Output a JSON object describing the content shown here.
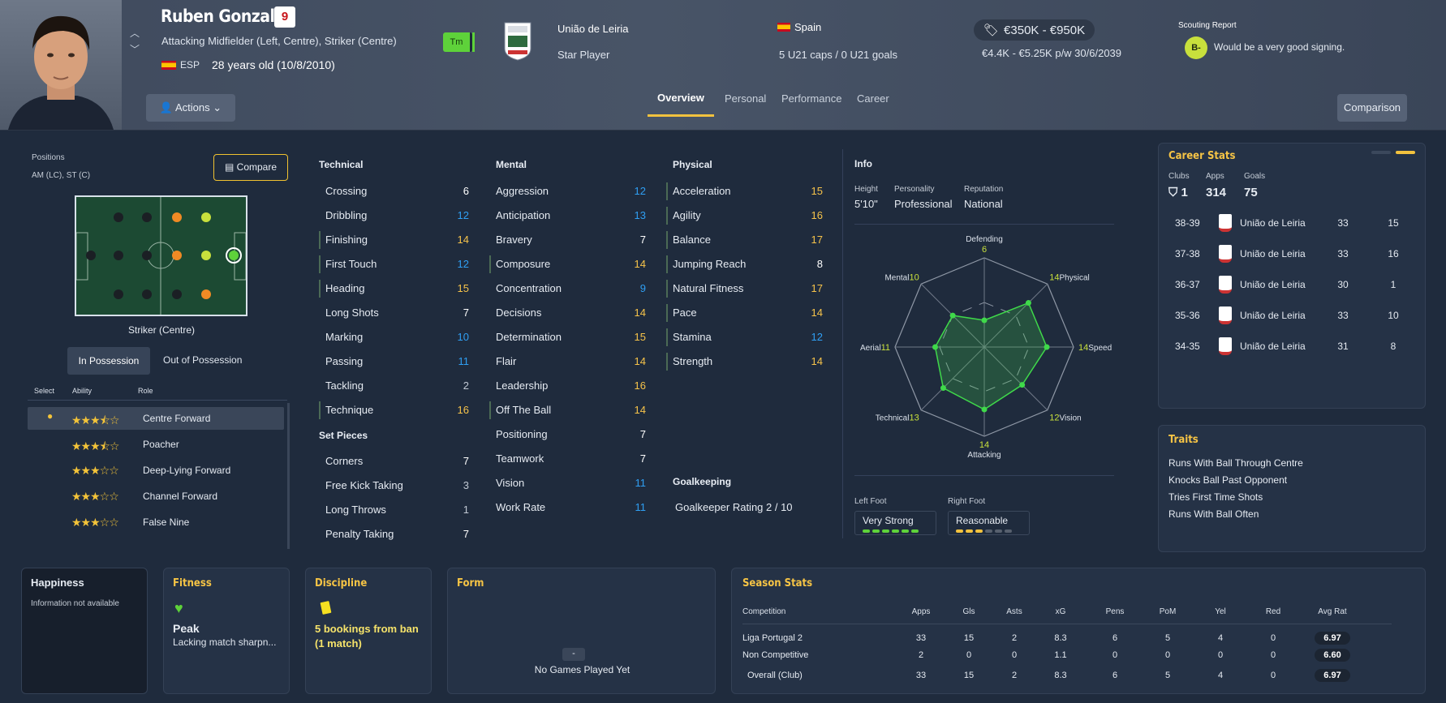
{
  "header": {
    "name": "Ruben Gonzalez",
    "shirt_number": "9",
    "positions_text": "Attacking Midfielder (Left, Centre), Striker (Centre)",
    "nationality_code": "ESP",
    "age_text": "28 years old (10/8/2010)",
    "tm_badge": "Tm",
    "club": "União de Leiria",
    "status": "Star Player",
    "country": "Spain",
    "caps": "5 U21 caps / 0 U21 goals",
    "value": "€350K - €950K",
    "wage": "€4.4K - €5.25K p/w 30/6/2039",
    "scouting_title": "Scouting Report",
    "scouting_grade": "B-",
    "scouting_text": "Would be a very good signing.",
    "actions_label": "Actions",
    "comparison_label": "Comparison",
    "tabs": [
      "Overview",
      "Personal",
      "Performance",
      "Career"
    ]
  },
  "positions": {
    "title": "Positions",
    "value": "AM (LC), ST (C)",
    "compare_label": "Compare",
    "pitch_label": "Striker (Centre)",
    "toggle": [
      "In Possession",
      "Out of Possession"
    ],
    "table_headers": [
      "Select",
      "Ability",
      "Role"
    ],
    "roles": [
      {
        "stars": "★★★⯪☆",
        "name": "Centre Forward",
        "selected": true
      },
      {
        "stars": "★★★⯪☆",
        "name": "Poacher",
        "selected": false
      },
      {
        "stars": "★★★☆☆",
        "name": "Deep-Lying Forward",
        "selected": false
      },
      {
        "stars": "★★★☆☆",
        "name": "Channel Forward",
        "selected": false
      },
      {
        "stars": "★★★☆☆",
        "name": "False Nine",
        "selected": false
      }
    ]
  },
  "technical": {
    "title": "Technical",
    "attrs": [
      {
        "name": "Crossing",
        "value": "6"
      },
      {
        "name": "Dribbling",
        "value": "12"
      },
      {
        "name": "Finishing",
        "value": "14"
      },
      {
        "name": "First Touch",
        "value": "12"
      },
      {
        "name": "Heading",
        "value": "15"
      },
      {
        "name": "Long Shots",
        "value": "7"
      },
      {
        "name": "Marking",
        "value": "10"
      },
      {
        "name": "Passing",
        "value": "11"
      },
      {
        "name": "Tackling",
        "value": "2"
      },
      {
        "name": "Technique",
        "value": "16"
      }
    ]
  },
  "set_pieces": {
    "title": "Set Pieces",
    "attrs": [
      {
        "name": "Corners",
        "value": "7"
      },
      {
        "name": "Free Kick Taking",
        "value": "3"
      },
      {
        "name": "Long Throws",
        "value": "1"
      },
      {
        "name": "Penalty Taking",
        "value": "7"
      }
    ]
  },
  "mental": {
    "title": "Mental",
    "attrs": [
      {
        "name": "Aggression",
        "value": "12"
      },
      {
        "name": "Anticipation",
        "value": "13"
      },
      {
        "name": "Bravery",
        "value": "7"
      },
      {
        "name": "Composure",
        "value": "14"
      },
      {
        "name": "Concentration",
        "value": "9"
      },
      {
        "name": "Decisions",
        "value": "14"
      },
      {
        "name": "Determination",
        "value": "15"
      },
      {
        "name": "Flair",
        "value": "14"
      },
      {
        "name": "Leadership",
        "value": "16"
      },
      {
        "name": "Off The Ball",
        "value": "14"
      },
      {
        "name": "Positioning",
        "value": "7"
      },
      {
        "name": "Teamwork",
        "value": "7"
      },
      {
        "name": "Vision",
        "value": "11"
      },
      {
        "name": "Work Rate",
        "value": "11"
      }
    ]
  },
  "physical": {
    "title": "Physical",
    "attrs": [
      {
        "name": "Acceleration",
        "value": "15"
      },
      {
        "name": "Agility",
        "value": "16"
      },
      {
        "name": "Balance",
        "value": "17"
      },
      {
        "name": "Jumping Reach",
        "value": "8"
      },
      {
        "name": "Natural Fitness",
        "value": "17"
      },
      {
        "name": "Pace",
        "value": "14"
      },
      {
        "name": "Stamina",
        "value": "12"
      },
      {
        "name": "Strength",
        "value": "14"
      }
    ]
  },
  "goalkeeping": {
    "title": "Goalkeeping",
    "rating": "Goalkeeper Rating 2 / 10"
  },
  "info": {
    "title": "Info",
    "height_label": "Height",
    "height": "5'10\"",
    "personality_label": "Personality",
    "personality": "Professional",
    "reputation_label": "Reputation",
    "reputation": "National",
    "left_foot_label": "Left Foot",
    "left_foot": "Very Strong",
    "right_foot_label": "Right Foot",
    "right_foot": "Reasonable"
  },
  "radar": {
    "axes": [
      {
        "label": "Defending",
        "value": 6
      },
      {
        "label": "Physical",
        "value": 14
      },
      {
        "label": "Speed",
        "value": 14
      },
      {
        "label": "Vision",
        "value": 12
      },
      {
        "label": "Attacking",
        "value": 14
      },
      {
        "label": "Technical",
        "value": 13
      },
      {
        "label": "Aerial",
        "value": 11
      },
      {
        "label": "Mental",
        "value": 10
      }
    ],
    "max": 20,
    "color": "#3fd94a"
  },
  "career": {
    "title": "Career Stats",
    "clubs_label": "Clubs",
    "clubs": "1",
    "apps_label": "Apps",
    "apps": "314",
    "goals_label": "Goals",
    "goals": "75",
    "seasons": [
      {
        "season": "38-39",
        "club": "União de Leiria",
        "apps": "33",
        "goals": "15"
      },
      {
        "season": "37-38",
        "club": "União de Leiria",
        "apps": "33",
        "goals": "16"
      },
      {
        "season": "36-37",
        "club": "União de Leiria",
        "apps": "30",
        "goals": "1"
      },
      {
        "season": "35-36",
        "club": "União de Leiria",
        "apps": "33",
        "goals": "10"
      },
      {
        "season": "34-35",
        "club": "União de Leiria",
        "apps": "31",
        "goals": "8"
      }
    ]
  },
  "traits": {
    "title": "Traits",
    "items": [
      "Runs With Ball Through Centre",
      "Knocks Ball Past Opponent",
      "Tries First Time Shots",
      "Runs With Ball Often"
    ]
  },
  "happiness": {
    "title": "Happiness",
    "text": "Information not available"
  },
  "fitness": {
    "title": "Fitness",
    "status": "Peak",
    "text": "Lacking match sharpn..."
  },
  "discipline": {
    "title": "Discipline",
    "text": "5 bookings from ban (1 match)"
  },
  "form": {
    "title": "Form",
    "dash": "-",
    "text": "No Games Played Yet"
  },
  "season_stats": {
    "title": "Season Stats",
    "headers": [
      "Competition",
      "Apps",
      "Gls",
      "Asts",
      "xG",
      "Pens",
      "PoM",
      "Yel",
      "Red",
      "Avg Rat"
    ],
    "rows": [
      [
        "Liga Portugal 2",
        "33",
        "15",
        "2",
        "8.3",
        "6",
        "5",
        "4",
        "0",
        "6.97"
      ],
      [
        "Non Competitive",
        "2",
        "0",
        "0",
        "1.1",
        "0",
        "0",
        "0",
        "0",
        "6.60"
      ],
      [
        "Overall (Club)",
        "33",
        "15",
        "2",
        "8.3",
        "6",
        "5",
        "4",
        "0",
        "6.97"
      ]
    ]
  }
}
